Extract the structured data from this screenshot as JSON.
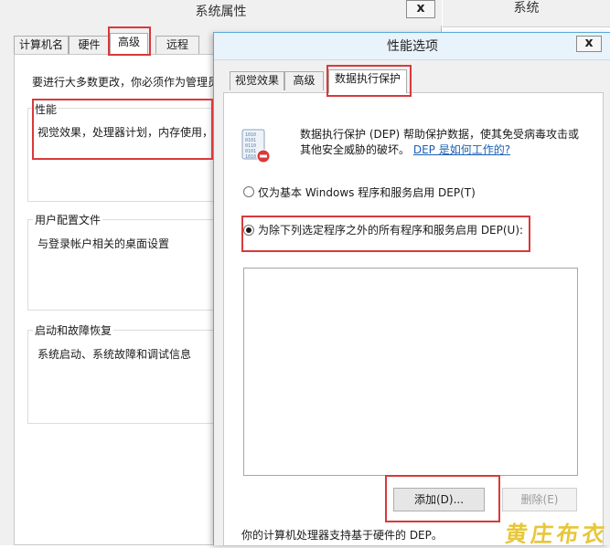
{
  "system_properties": {
    "title": "系统属性",
    "close_label": "x",
    "tabs": [
      {
        "label": "计算机名"
      },
      {
        "label": "硬件"
      },
      {
        "label": "高级"
      },
      {
        "label": "远程"
      }
    ],
    "admin_notice": "要进行大多数更改，你必须作为管理员",
    "performance": {
      "caption": "性能",
      "description": "视觉效果，处理器计划，内存使用，"
    },
    "user_profiles": {
      "caption": "用户配置文件",
      "description": "与登录帐户相关的桌面设置"
    },
    "startup_recovery": {
      "caption": "启动和故障恢复",
      "description": "系统启动、系统故障和调试信息"
    }
  },
  "right_window": {
    "title": "系统"
  },
  "performance_options": {
    "title": "性能选项",
    "close_label": "x",
    "tabs": [
      {
        "label": "视觉效果"
      },
      {
        "label": "高级"
      },
      {
        "label": "数据执行保护"
      }
    ],
    "dep_description_line1": "数据执行保护 (DEP) 帮助保护数据，使其免受病毒攻击或",
    "dep_description_line2": "其他安全威胁的破坏。",
    "dep_link": "DEP 是如何工作的?",
    "radio_essential": "仅为基本 Windows 程序和服务启用 DEP(T)",
    "radio_all_except": "为除下列选定程序之外的所有程序和服务启用 DEP(U):",
    "add_button": "添加(D)...",
    "remove_button": "删除(E)",
    "hardware_support": "你的计算机处理器支持基于硬件的 DEP。"
  },
  "icon_lines": [
    "1010",
    "0101",
    "0110",
    "0101",
    "1010"
  ],
  "watermark": "黄庄布衣",
  "colors": {
    "highlight": "#d9393b",
    "link": "#1a5fb4",
    "dialog_border": "#5aa9d8",
    "watermark": "#e8c63a"
  },
  "icons": {
    "dep_icon": "dep-shield-icon",
    "close_icon": "close-icon"
  }
}
